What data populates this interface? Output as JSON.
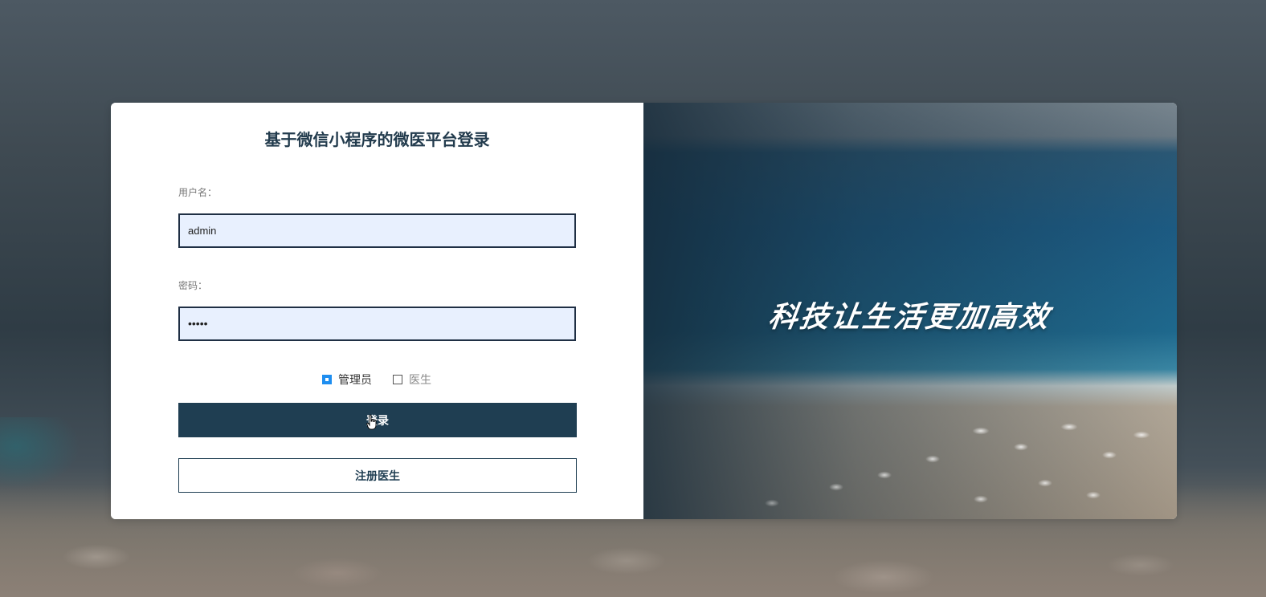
{
  "login": {
    "title": "基于微信小程序的微医平台登录",
    "username_label": "用户名：",
    "username_value": "admin",
    "password_label": "密码：",
    "password_value": "•••••",
    "roles": [
      {
        "label": "管理员",
        "checked": true
      },
      {
        "label": "医生",
        "checked": false
      }
    ],
    "login_button": "登录",
    "register_button": "注册医生"
  },
  "banner": {
    "slogan": "科技让生活更加高效"
  },
  "colors": {
    "primary": "#1f3e52",
    "input_bg": "#e8f0fe",
    "checkbox_accent": "#1e8ef0"
  }
}
